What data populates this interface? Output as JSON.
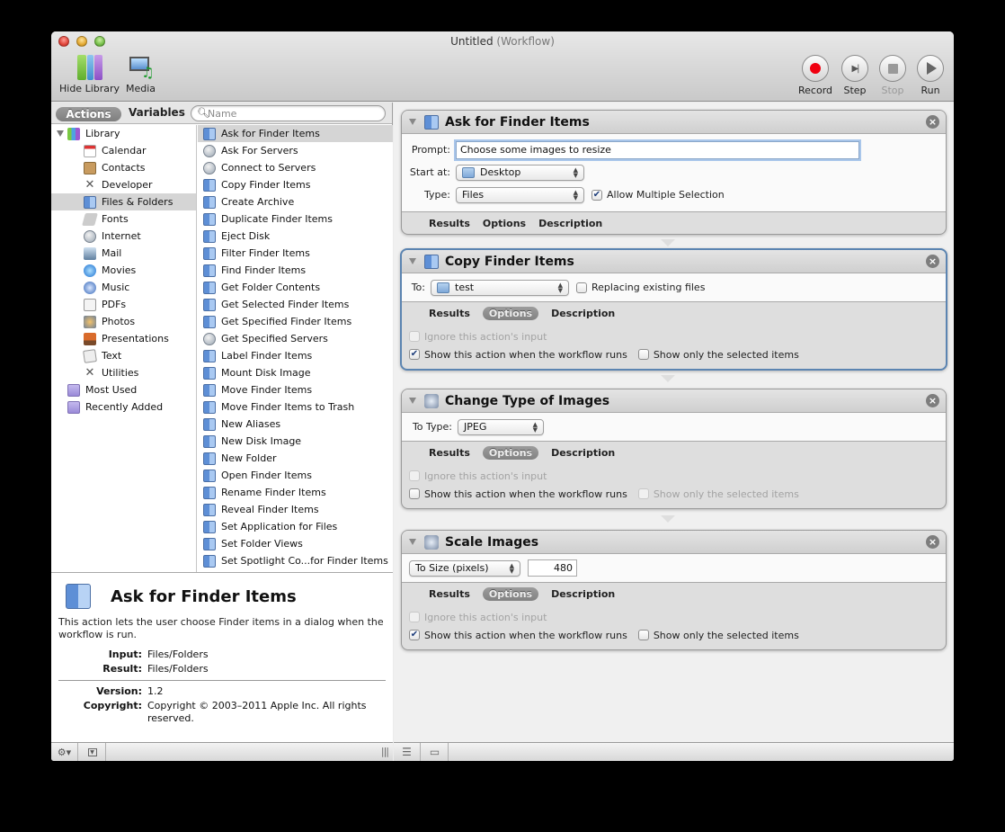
{
  "window": {
    "title": "Untitled",
    "title_suffix": "(Workflow)"
  },
  "toolbar": {
    "hide_library": "Hide Library",
    "media": "Media",
    "record": "Record",
    "step": "Step",
    "stop": "Stop",
    "run": "Run"
  },
  "library_header": {
    "actions_tab": "Actions",
    "variables_tab": "Variables",
    "search_placeholder": "Name"
  },
  "library": {
    "root": "Library",
    "categories": [
      {
        "label": "Calendar",
        "icon": "calendar-icon"
      },
      {
        "label": "Contacts",
        "icon": "contacts-icon"
      },
      {
        "label": "Developer",
        "icon": "developer-icon"
      },
      {
        "label": "Files & Folders",
        "icon": "finder-icon",
        "selected": true
      },
      {
        "label": "Fonts",
        "icon": "fonts-icon"
      },
      {
        "label": "Internet",
        "icon": "internet-icon"
      },
      {
        "label": "Mail",
        "icon": "mail-icon"
      },
      {
        "label": "Movies",
        "icon": "movies-icon"
      },
      {
        "label": "Music",
        "icon": "music-icon"
      },
      {
        "label": "PDFs",
        "icon": "pdf-icon"
      },
      {
        "label": "Photos",
        "icon": "photos-icon"
      },
      {
        "label": "Presentations",
        "icon": "presentations-icon"
      },
      {
        "label": "Text",
        "icon": "text-icon"
      },
      {
        "label": "Utilities",
        "icon": "utilities-icon"
      }
    ],
    "smart_groups": [
      {
        "label": "Most Used",
        "icon": "smart-folder-icon"
      },
      {
        "label": "Recently Added",
        "icon": "smart-folder-icon"
      }
    ]
  },
  "actions_list": [
    {
      "label": "Ask for Finder Items",
      "icon": "finder",
      "selected": true
    },
    {
      "label": "Ask For Servers",
      "icon": "globe"
    },
    {
      "label": "Connect to Servers",
      "icon": "globe"
    },
    {
      "label": "Copy Finder Items",
      "icon": "finder"
    },
    {
      "label": "Create Archive",
      "icon": "finder"
    },
    {
      "label": "Duplicate Finder Items",
      "icon": "finder"
    },
    {
      "label": "Eject Disk",
      "icon": "finder"
    },
    {
      "label": "Filter Finder Items",
      "icon": "finder"
    },
    {
      "label": "Find Finder Items",
      "icon": "finder"
    },
    {
      "label": "Get Folder Contents",
      "icon": "finder"
    },
    {
      "label": "Get Selected Finder Items",
      "icon": "finder"
    },
    {
      "label": "Get Specified Finder Items",
      "icon": "finder"
    },
    {
      "label": "Get Specified Servers",
      "icon": "globe"
    },
    {
      "label": "Label Finder Items",
      "icon": "finder"
    },
    {
      "label": "Mount Disk Image",
      "icon": "finder"
    },
    {
      "label": "Move Finder Items",
      "icon": "finder"
    },
    {
      "label": "Move Finder Items to Trash",
      "icon": "finder"
    },
    {
      "label": "New Aliases",
      "icon": "finder"
    },
    {
      "label": "New Disk Image",
      "icon": "finder"
    },
    {
      "label": "New Folder",
      "icon": "finder"
    },
    {
      "label": "Open Finder Items",
      "icon": "finder"
    },
    {
      "label": "Rename Finder Items",
      "icon": "finder"
    },
    {
      "label": "Reveal Finder Items",
      "icon": "finder"
    },
    {
      "label": "Set Application for Files",
      "icon": "finder"
    },
    {
      "label": "Set Folder Views",
      "icon": "finder"
    },
    {
      "label": "Set Spotlight Co...for Finder Items",
      "icon": "finder"
    }
  ],
  "description": {
    "title": "Ask for Finder Items",
    "text": "This action lets the user choose Finder items in a dialog when the workflow is run.",
    "input_label": "Input:",
    "input_value": "Files/Folders",
    "result_label": "Result:",
    "result_value": "Files/Folders",
    "version_label": "Version:",
    "version_value": "1.2",
    "copyright_label": "Copyright:",
    "copyright_value": "Copyright © 2003–2011 Apple Inc.  All rights reserved."
  },
  "workflow": {
    "tabs": {
      "results": "Results",
      "options": "Options",
      "description": "Description"
    },
    "ignore_input": "Ignore this action's input",
    "show_when_runs": "Show this action when the workflow runs",
    "show_only_selected": "Show only the selected items",
    "ask": {
      "title": "Ask for Finder Items",
      "prompt_label": "Prompt:",
      "prompt_value": "Choose some images to resize",
      "start_label": "Start at:",
      "start_value": "Desktop",
      "type_label": "Type:",
      "type_value": "Files",
      "allow_multiple": "Allow Multiple Selection",
      "allow_multiple_checked": true
    },
    "copy": {
      "title": "Copy Finder Items",
      "to_label": "To:",
      "to_value": "test",
      "replacing": "Replacing existing files",
      "replacing_checked": false,
      "show_when_runs_checked": true,
      "show_only_selected_checked": false
    },
    "change": {
      "title": "Change Type of Images",
      "to_type_label": "To Type:",
      "to_type_value": "JPEG",
      "show_when_runs_checked": false,
      "show_only_selected_checked": false
    },
    "scale": {
      "title": "Scale Images",
      "mode_value": "To Size (pixels)",
      "size_value": "480",
      "show_when_runs_checked": true,
      "show_only_selected_checked": false
    }
  }
}
